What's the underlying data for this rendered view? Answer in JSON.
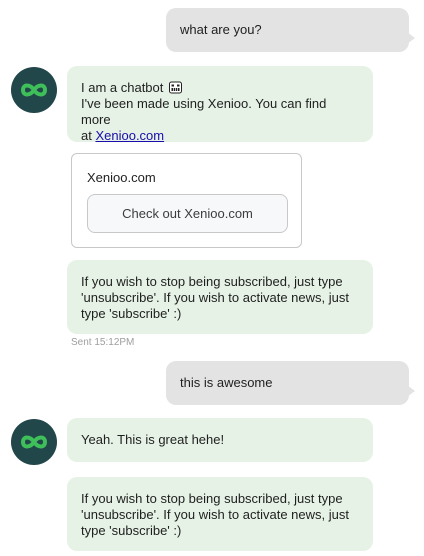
{
  "messages": {
    "m1": {
      "sender": "user",
      "text": "what are you?"
    },
    "m2": {
      "sender": "bot",
      "line1": "I am a chatbot",
      "emoji_icon": "grinning-face-emoji-icon",
      "line2": "I've been made using Xenioo. You can find more",
      "line3_prefix": "at ",
      "link_text": "Xenioo.com"
    },
    "card": {
      "title": "Xenioo.com",
      "button_label": "Check out Xenioo.com"
    },
    "m3": {
      "sender": "bot",
      "line1": "If you wish to stop being subscribed, just type",
      "line2": "'unsubscribe'. If you wish to activate news, just",
      "line3": "type 'subscribe' :)"
    },
    "timestamp": "Sent 15:12PM",
    "m4": {
      "sender": "user",
      "text": "this is awesome"
    },
    "m5": {
      "sender": "bot",
      "text": "Yeah. This is great hehe!"
    },
    "m6": {
      "sender": "bot",
      "line1": "If you wish to stop being subscribed, just type",
      "line2": "'unsubscribe'. If you wish to activate news, just",
      "line3": "type 'subscribe' :)"
    }
  },
  "avatar_icon": "infinity-logo-icon",
  "colors": {
    "user_bubble": "#e3e3e3",
    "bot_bubble": "#e6f2e6",
    "avatar_bg": "#22474a",
    "avatar_logo": "#3fbf5a",
    "link": "#1a0dab"
  }
}
